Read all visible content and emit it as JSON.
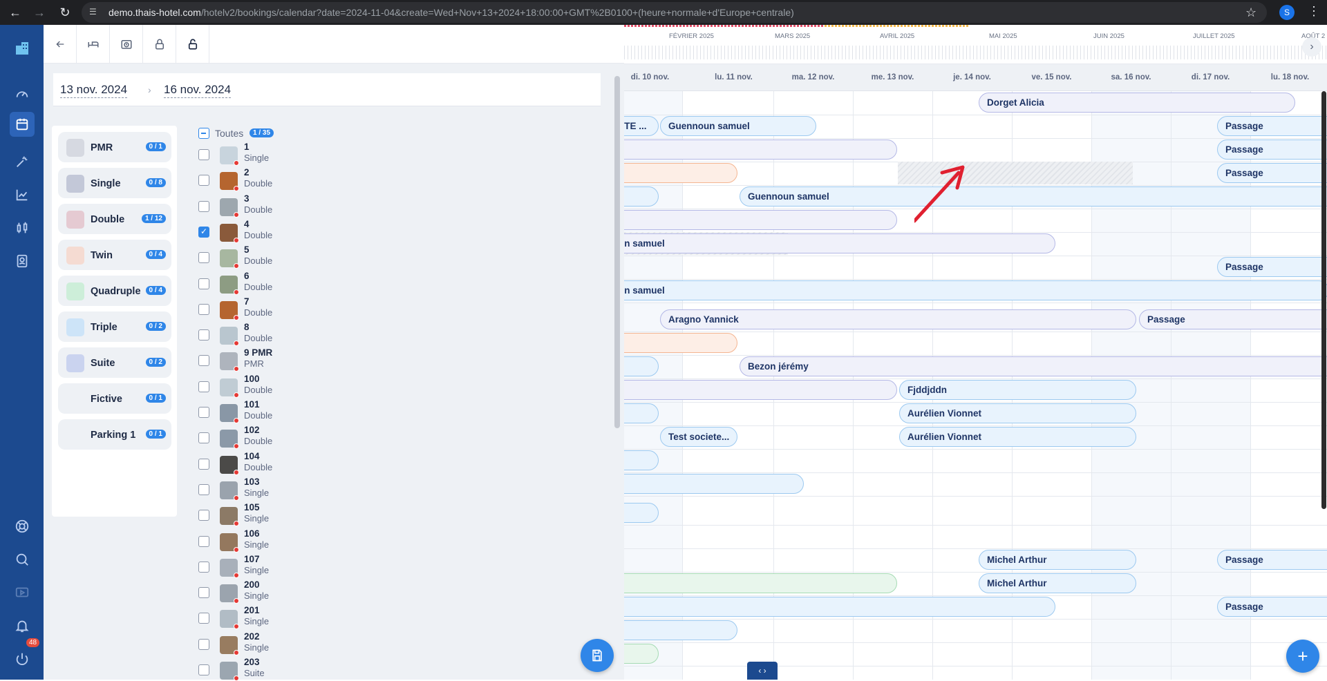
{
  "browser": {
    "url_host": "demo.thais-hotel.com",
    "url_path": "/hotelv2/bookings/calendar?date=2024-11-04&create=Wed+Nov+13+2024+18:00:00+GMT%2B0100+(heure+normale+d'Europe+centrale)",
    "profile_initial": "S"
  },
  "sidebar": {
    "notification_count": "48"
  },
  "dates": {
    "start": "13 nov. 2024",
    "separator": "›",
    "end": "16 nov. 2024"
  },
  "room_types": [
    {
      "label": "PMR",
      "badge": "0 / 1",
      "color": "#d6d9e1"
    },
    {
      "label": "Single",
      "badge": "0 / 8",
      "color": "#c3c8d8"
    },
    {
      "label": "Double",
      "badge": "1 / 12",
      "color": "#e5cad2"
    },
    {
      "label": "Twin",
      "badge": "0 / 4",
      "color": "#f5dbd2"
    },
    {
      "label": "Quadruple",
      "badge": "0 / 4",
      "color": "#cdeed9"
    },
    {
      "label": "Triple",
      "badge": "0 / 2",
      "color": "#cde4f8"
    },
    {
      "label": "Suite",
      "badge": "0 / 2",
      "color": "#cad3ef"
    },
    {
      "label": "Fictive",
      "badge": "0 / 1",
      "color": ""
    },
    {
      "label": "Parking 1",
      "badge": "0 / 1",
      "color": ""
    }
  ],
  "rooms_header": {
    "label": "Toutes",
    "badge": "1 / 35"
  },
  "rooms": [
    {
      "num": "1",
      "type": "Single",
      "checked": false
    },
    {
      "num": "2",
      "type": "Double",
      "checked": false
    },
    {
      "num": "3",
      "type": "Double",
      "checked": false
    },
    {
      "num": "4",
      "type": "Double",
      "checked": true
    },
    {
      "num": "5",
      "type": "Double",
      "checked": false
    },
    {
      "num": "6",
      "type": "Double",
      "checked": false
    },
    {
      "num": "7",
      "type": "Double",
      "checked": false
    },
    {
      "num": "8",
      "type": "Double",
      "checked": false
    },
    {
      "num": "9 PMR",
      "type": "PMR",
      "checked": false
    },
    {
      "num": "100",
      "type": "Double",
      "checked": false
    },
    {
      "num": "101",
      "type": "Double",
      "checked": false
    },
    {
      "num": "102",
      "type": "Double",
      "checked": false
    },
    {
      "num": "104",
      "type": "Double",
      "checked": false
    },
    {
      "num": "103",
      "type": "Single",
      "checked": false
    },
    {
      "num": "105",
      "type": "Single",
      "checked": false
    },
    {
      "num": "106",
      "type": "Single",
      "checked": false
    },
    {
      "num": "107",
      "type": "Single",
      "checked": false
    },
    {
      "num": "200",
      "type": "Single",
      "checked": false
    },
    {
      "num": "201",
      "type": "Single",
      "checked": false
    },
    {
      "num": "202",
      "type": "Single",
      "checked": false
    },
    {
      "num": "203",
      "type": "Suite",
      "checked": false
    }
  ],
  "timeline_months": [
    "FÉVRIER 2025",
    "MARS 2025",
    "AVRIL 2025",
    "MAI 2025",
    "JUIN 2025",
    "JUILLET 2025",
    "AOÛT 2"
  ],
  "days": [
    "di. 10 nov.",
    "lu. 11 nov.",
    "ma. 12 nov.",
    "me. 13 nov.",
    "je. 14 nov.",
    "ve. 15 nov.",
    "sa. 16 nov.",
    "di. 17 nov.",
    "lu. 18 nov."
  ],
  "bookings": [
    {
      "label": "Dorget Alicia",
      "style": "b-lav"
    },
    {
      "label": "TTE ...",
      "style": "b-blue"
    },
    {
      "label": "Guennoun samuel",
      "style": "b-blue"
    },
    {
      "label": "Passage",
      "style": "b-blue"
    },
    {
      "label": "",
      "style": "b-lav"
    },
    {
      "label": "Passage",
      "style": "b-blue"
    },
    {
      "label": "",
      "style": "b-orange"
    },
    {
      "label": "Passage",
      "style": "b-blue"
    },
    {
      "label": "",
      "style": "b-blue"
    },
    {
      "label": "Guennoun samuel",
      "style": "b-blue"
    },
    {
      "label": "",
      "style": "b-lav"
    },
    {
      "label": "un samuel",
      "style": "b-lav"
    },
    {
      "label": "Passage",
      "style": "b-blue"
    },
    {
      "label": "un samuel",
      "style": "b-blue"
    },
    {
      "label": "Aragno Yannick",
      "style": "b-lav"
    },
    {
      "label": "Passage",
      "style": "b-lav"
    },
    {
      "label": "",
      "style": "b-orange"
    },
    {
      "label": "",
      "style": "b-blue"
    },
    {
      "label": "Bezon jérémy",
      "style": "b-lav"
    },
    {
      "label": "",
      "style": "b-lav"
    },
    {
      "label": "Fjddjddn",
      "style": "b-blue"
    },
    {
      "label": "",
      "style": "b-blue"
    },
    {
      "label": "Aurélien Vionnet",
      "style": "b-blue"
    },
    {
      "label": "Test societe...",
      "style": "b-blue"
    },
    {
      "label": "Aurélien Vionnet",
      "style": "b-blue"
    },
    {
      "label": "",
      "style": "b-blue"
    },
    {
      "label": "",
      "style": "b-blue"
    },
    {
      "label": "",
      "style": "b-blue"
    },
    {
      "label": "Michel Arthur",
      "style": "b-blue"
    },
    {
      "label": "Passage",
      "style": "b-blue"
    },
    {
      "label": "",
      "style": "b-green"
    },
    {
      "label": "Michel Arthur",
      "style": "b-blue"
    },
    {
      "label": "",
      "style": "b-blue"
    },
    {
      "label": "Passage",
      "style": "b-blue"
    },
    {
      "label": "",
      "style": "b-blue"
    },
    {
      "label": "",
      "style": "b-green"
    }
  ],
  "colors": {
    "sidebar": "#1c4a8f",
    "accent": "#2f86e8",
    "annotation_arrow": "#e02030"
  }
}
